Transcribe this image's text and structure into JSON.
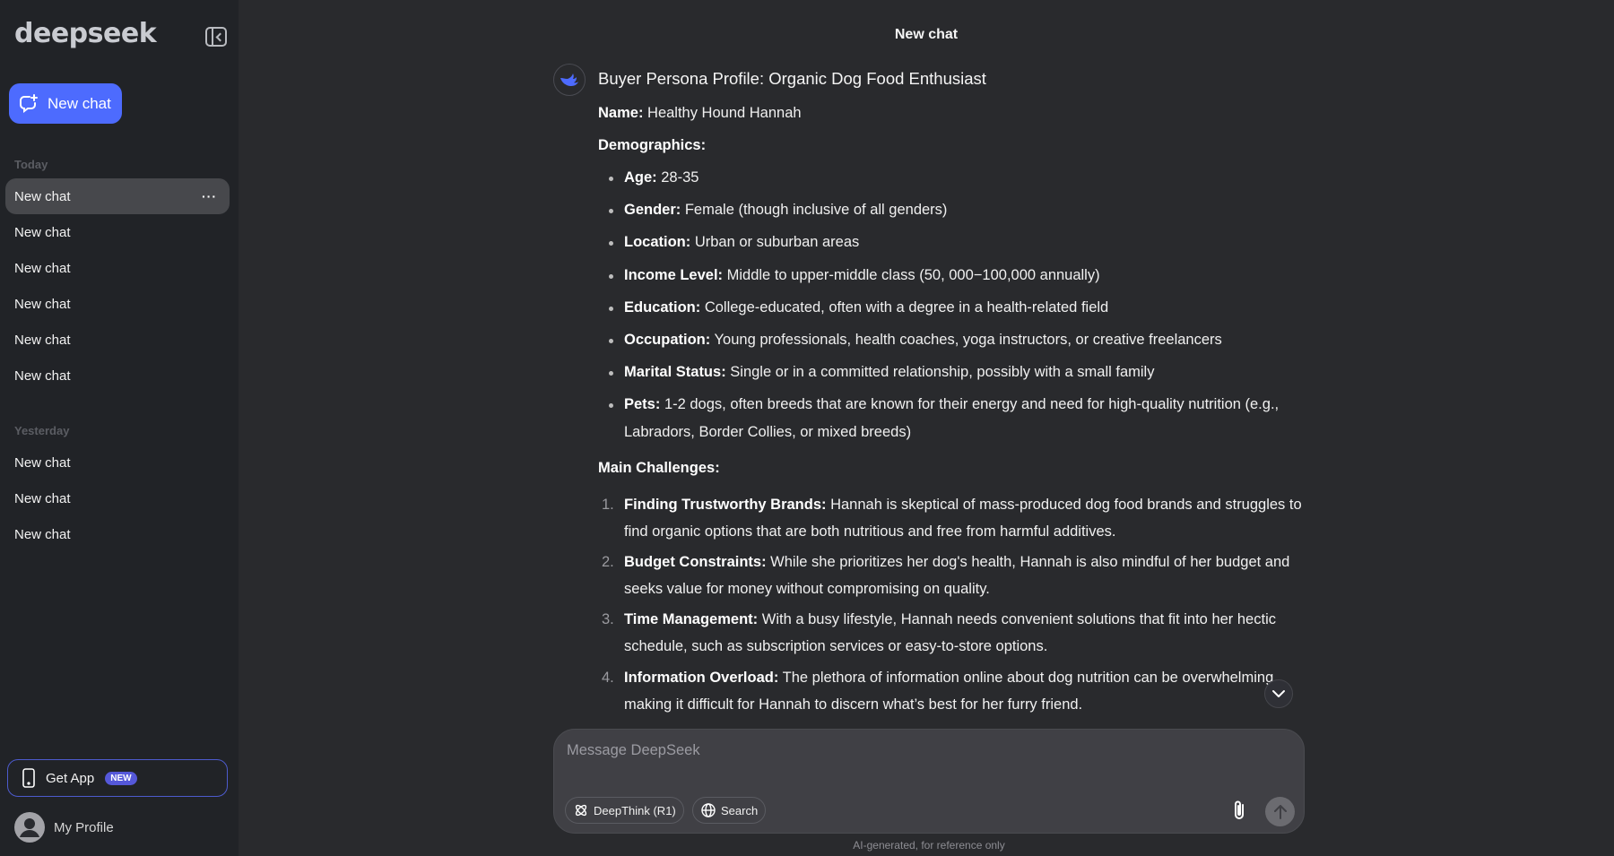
{
  "sidebar": {
    "logo": "deepseek",
    "new_chat_label": "New chat",
    "sections": [
      {
        "label": "Today",
        "items": [
          "New chat",
          "New chat",
          "New chat",
          "New chat",
          "New chat",
          "New chat"
        ]
      },
      {
        "label": "Yesterday",
        "items": [
          "New chat",
          "New chat",
          "New chat"
        ]
      }
    ],
    "active_item_more": "···",
    "get_app_label": "Get App",
    "get_app_badge": "NEW",
    "profile_label": "My Profile"
  },
  "header": {
    "title": "New chat"
  },
  "message": {
    "heading": "Buyer Persona Profile: Organic Dog Food Enthusiast",
    "name_label": "Name:",
    "name_value": " Healthy Hound Hannah",
    "demographics_heading": "Demographics:",
    "demographics": [
      {
        "label": "Age:",
        "value": " 28-35"
      },
      {
        "label": "Gender:",
        "value": " Female (though inclusive of all genders)"
      },
      {
        "label": "Location:",
        "value": " Urban or suburban areas"
      },
      {
        "label": "Income Level:",
        "value": " Middle to upper-middle class (50, 000−100,000 annually)"
      },
      {
        "label": "Education:",
        "value": " College-educated, often with a degree in a health-related field"
      },
      {
        "label": "Occupation:",
        "value": " Young professionals, health coaches, yoga instructors, or creative freelancers"
      },
      {
        "label": "Marital Status:",
        "value": " Single or in a committed relationship, possibly with a small family"
      },
      {
        "label": "Pets:",
        "value": " 1-2 dogs, often breeds that are known for their energy and need for high-quality nutrition (e.g., Labradors, Border Collies, or mixed breeds)"
      }
    ],
    "challenges_heading": "Main Challenges:",
    "challenges": [
      {
        "num": "1.",
        "label": "Finding Trustworthy Brands:",
        "value": " Hannah is skeptical of mass-produced dog food brands and struggles to find organic options that are both nutritious and free from harmful additives."
      },
      {
        "num": "2.",
        "label": "Budget Constraints:",
        "value": " While she prioritizes her dog's health, Hannah is also mindful of her budget and seeks value for money without compromising on quality."
      },
      {
        "num": "3.",
        "label": "Time Management:",
        "value": " With a busy lifestyle, Hannah needs convenient solutions that fit into her hectic schedule, such as subscription services or easy-to-store options."
      },
      {
        "num": "4.",
        "label": "Information Overload:",
        "value": " The plethora of information online about dog nutrition can be overwhelming, making it difficult for Hannah to discern what’s best for her furry friend."
      }
    ]
  },
  "composer": {
    "placeholder": "Message DeepSeek",
    "value": "",
    "deepthink_label": "DeepThink (R1)",
    "search_label": "Search"
  },
  "footer_note": "AI-generated, for reference only",
  "colors": {
    "accent": "#4d6bfe",
    "sidebar_bg": "#212327",
    "main_bg": "#292a2d",
    "composer_bg": "#404045",
    "badge": "#5558d9"
  }
}
